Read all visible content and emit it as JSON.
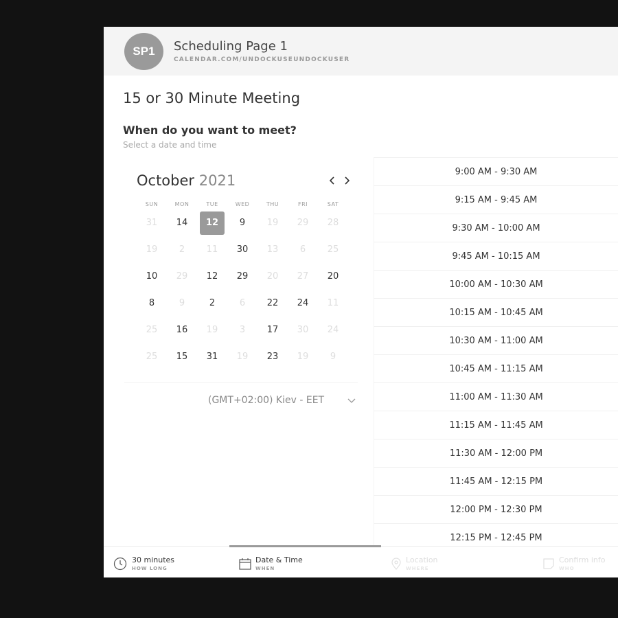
{
  "header": {
    "avatar_initials": "SP1",
    "page_name": "Scheduling Page 1",
    "page_url": "CALENDAR.COM/UNDOCKUSEUNDOCKUSER"
  },
  "event": {
    "title": "15 or 30 Minute Meeting",
    "question": "When do you want to meet?",
    "question_sub": "Select a date and time"
  },
  "calendar": {
    "month": "October",
    "year": "2021",
    "weekdays": [
      "SUN",
      "MON",
      "TUE",
      "WED",
      "THU",
      "FRI",
      "SAT"
    ],
    "weeks": [
      [
        {
          "d": "31",
          "f": true
        },
        {
          "d": "14",
          "f": false
        },
        {
          "d": "12",
          "f": false,
          "sel": true
        },
        {
          "d": "9",
          "f": false
        },
        {
          "d": "19",
          "f": true
        },
        {
          "d": "29",
          "f": true
        },
        {
          "d": "28",
          "f": true
        }
      ],
      [
        {
          "d": "19",
          "f": true
        },
        {
          "d": "2",
          "f": true
        },
        {
          "d": "11",
          "f": true
        },
        {
          "d": "30",
          "f": false
        },
        {
          "d": "13",
          "f": true
        },
        {
          "d": "6",
          "f": true
        },
        {
          "d": "25",
          "f": true
        }
      ],
      [
        {
          "d": "10",
          "f": false
        },
        {
          "d": "29",
          "f": true
        },
        {
          "d": "12",
          "f": false
        },
        {
          "d": "29",
          "f": false
        },
        {
          "d": "20",
          "f": true
        },
        {
          "d": "27",
          "f": true
        },
        {
          "d": "20",
          "f": false
        }
      ],
      [
        {
          "d": "8",
          "f": false
        },
        {
          "d": "9",
          "f": true
        },
        {
          "d": "2",
          "f": false
        },
        {
          "d": "6",
          "f": true
        },
        {
          "d": "22",
          "f": false
        },
        {
          "d": "24",
          "f": false
        },
        {
          "d": "11",
          "f": true
        }
      ],
      [
        {
          "d": "25",
          "f": true
        },
        {
          "d": "16",
          "f": false
        },
        {
          "d": "19",
          "f": true
        },
        {
          "d": "3",
          "f": true
        },
        {
          "d": "17",
          "f": false
        },
        {
          "d": "30",
          "f": true
        },
        {
          "d": "24",
          "f": true
        }
      ],
      [
        {
          "d": "25",
          "f": true
        },
        {
          "d": "15",
          "f": false
        },
        {
          "d": "31",
          "f": false
        },
        {
          "d": "19",
          "f": true
        },
        {
          "d": "23",
          "f": false
        },
        {
          "d": "19",
          "f": true
        },
        {
          "d": "9",
          "f": true
        }
      ]
    ],
    "timezone": "(GMT+02:00) Kiev - EET"
  },
  "time_slots": [
    "9:00 AM - 9:30 AM",
    "9:15 AM - 9:45 AM",
    "9:30 AM - 10:00 AM",
    "9:45 AM - 10:15 AM",
    "10:00 AM - 10:30 AM",
    "10:15 AM - 10:45 AM",
    "10:30 AM - 11:00 AM",
    "10:45 AM - 11:15 AM",
    "11:00 AM - 11:30 AM",
    "11:15 AM - 11:45 AM",
    "11:30 AM - 12:00 PM",
    "11:45 AM - 12:15 PM",
    "12:00 PM - 12:30 PM",
    "12:15 PM - 12:45 PM"
  ],
  "steps": [
    {
      "label": "30 minutes",
      "sub": "HOW LONG",
      "icon": "clock-icon",
      "state": "done"
    },
    {
      "label": "Date & Time",
      "sub": "WHEN",
      "icon": "calendar-icon",
      "state": "active"
    },
    {
      "label": "Location",
      "sub": "WHERE",
      "icon": "location-pin-icon",
      "state": "upcoming"
    },
    {
      "label": "Confirm info",
      "sub": "WHO",
      "icon": "note-icon",
      "state": "upcoming"
    }
  ],
  "colors": {
    "accent": "#9a9a9a",
    "backdrop": "#121212",
    "header_bg": "#f4f4f4"
  }
}
